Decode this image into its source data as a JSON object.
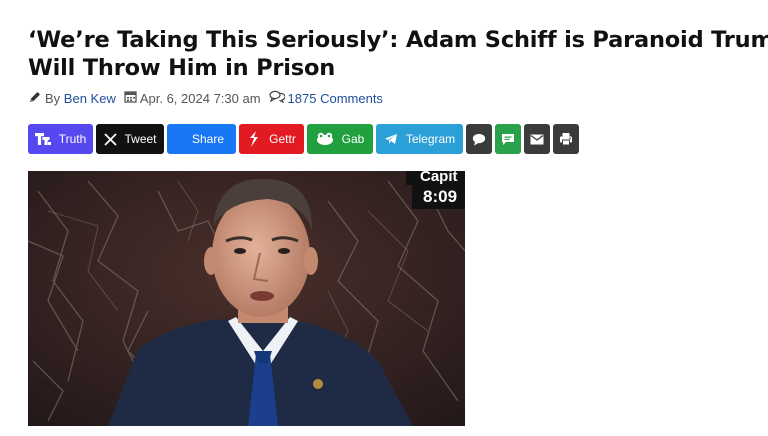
{
  "article": {
    "headline_line1": "‘We’re Taking This Seriously’: Adam Schiff is Paranoid Trump",
    "headline_line2": "Will Throw Him in Prison",
    "by_prefix": "By",
    "author": "Ben Kew",
    "date": "Apr. 6, 2024 7:30 am",
    "comments": "1875 Comments"
  },
  "share": {
    "buttons": [
      {
        "label": "Truth",
        "icon": "truth-social-icon",
        "color": "#5448ee"
      },
      {
        "label": "Tweet",
        "icon": "x-logo-icon",
        "color": "#111111"
      },
      {
        "label": "Share",
        "icon": "facebook-icon",
        "color": "#1877f2"
      },
      {
        "label": "Gettr",
        "icon": "gettr-icon",
        "color": "#e21b23"
      },
      {
        "label": "Gab",
        "icon": "gab-frog-icon",
        "color": "#21a040"
      },
      {
        "label": "Telegram",
        "icon": "telegram-icon",
        "color": "#2a9fd8"
      }
    ],
    "icon_buttons": [
      {
        "icon": "comment-icon",
        "color": "#3b3b3b"
      },
      {
        "icon": "sms-icon",
        "color": "#2aa14b"
      },
      {
        "icon": "email-icon",
        "color": "#3b3b3b"
      },
      {
        "icon": "print-icon",
        "color": "#3b3b3b"
      }
    ]
  },
  "image": {
    "chyron_top": "Capit",
    "chyron_time": "8:09"
  }
}
